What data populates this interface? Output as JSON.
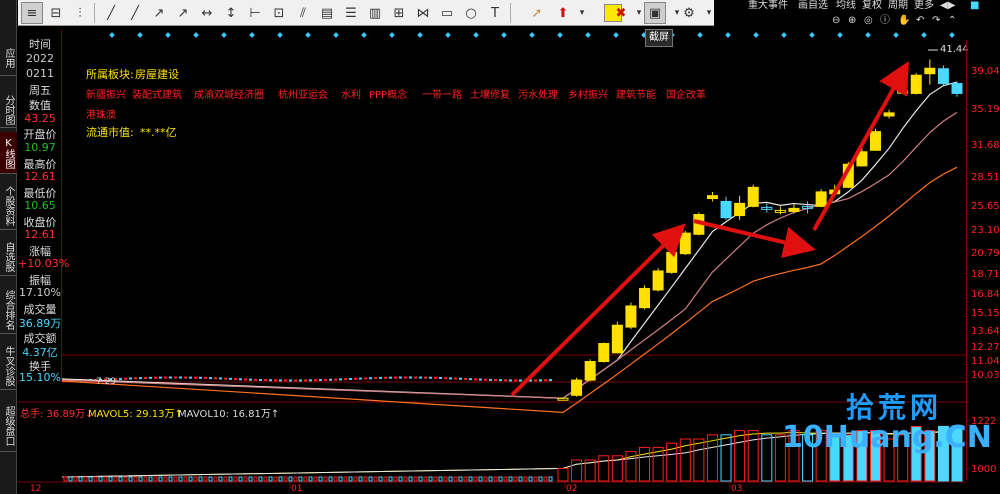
{
  "side_tabs": [
    {
      "label": "应用",
      "active": false
    },
    {
      "label": "分时图",
      "active": false
    },
    {
      "label": "K线图",
      "active": true
    },
    {
      "label": "个股资料",
      "active": false
    },
    {
      "label": "自选股",
      "active": false
    },
    {
      "label": "综合排名",
      "active": false
    },
    {
      "label": "牛叉诊股",
      "active": false
    },
    {
      "label": "超级盘口",
      "active": false
    }
  ],
  "info": {
    "time_label": "时间",
    "year": "2022",
    "date": "0211",
    "weekday": "周五",
    "value_label": "数值",
    "value": "43.25",
    "open_label": "开盘价",
    "open": "10.97",
    "high_label": "最高价",
    "high": "12.61",
    "low_label": "最低价",
    "low": "10.65",
    "close_label": "收盘价",
    "close": "12.61",
    "change_label": "涨幅",
    "change": "+10.03%",
    "amplitude_label": "振幅",
    "amplitude": "17.10%",
    "volume_label": "成交量",
    "volume": "36.89万",
    "turnover_label": "成交额",
    "turnover": "4.37亿",
    "turnover_rate_label": "换手",
    "turnover_rate": "15.10%"
  },
  "toolbar": {
    "tooltip": "截屏"
  },
  "top_menu": [
    "重大事件",
    "画自选",
    "均线",
    "复权",
    "周期",
    "更多"
  ],
  "stock_meta": {
    "sector_label": "所属板块:",
    "sector_value": "房屋建设",
    "concept_items": [
      "新疆振兴",
      "装配式建筑",
      "成渝双城经济圈",
      "杭州亚运会",
      "水利",
      "PPP概念",
      "一带一路",
      "土壤修复",
      "污水处理",
      "乡村振兴",
      "建筑节能",
      "国企改革"
    ],
    "concept_extra": "港珠澳",
    "float_label": "流通市值:",
    "float_value": "**.**亿"
  },
  "price_label": "7.29",
  "peak_label": "41.44",
  "volume_header": {
    "total": "总手: 36.89万↓",
    "ma5": "MAVOL5: 29.13万↑",
    "ma10": "MAVOL10: 16.81万↑"
  },
  "axis": {
    "y_ticks": [
      "39.04",
      "35.19",
      "31.68",
      "28.51",
      "25.65",
      "23.10",
      "20.79",
      "18.71",
      "16.84",
      "15.15",
      "13.64",
      "12.27",
      "11.04",
      "10.03"
    ],
    "vol_ticks": [
      "1222",
      "1000"
    ],
    "x_ticks": [
      "12",
      "01",
      "02",
      "03"
    ]
  },
  "watermark": {
    "cn": "拾荒网",
    "en": "10Huang.CN"
  },
  "colors": {
    "up": "#ff2020",
    "down": "#4ad8ff",
    "yellow": "#ffe000",
    "arrow": "#e01010",
    "ma_white": "#e8e8e8",
    "ma_pink": "#d08080",
    "ma_orange": "#ff7020"
  },
  "chart_data": {
    "type": "candlestick",
    "candles": [
      {
        "o": 7.29,
        "c": 7.29,
        "h": 7.32,
        "l": 7.26
      },
      {
        "o": 7.4,
        "c": 8.0,
        "h": 8.1,
        "l": 7.35
      },
      {
        "o": 8.0,
        "c": 8.8,
        "h": 8.9,
        "l": 7.95
      },
      {
        "o": 8.8,
        "c": 9.65,
        "h": 9.7,
        "l": 8.75
      },
      {
        "o": 9.2,
        "c": 10.6,
        "h": 10.8,
        "l": 9.2
      },
      {
        "o": 10.5,
        "c": 11.7,
        "h": 11.9,
        "l": 10.4
      },
      {
        "o": 11.6,
        "c": 12.8,
        "h": 13.0,
        "l": 11.5
      },
      {
        "o": 12.7,
        "c": 14.0,
        "h": 14.2,
        "l": 12.6
      },
      {
        "o": 13.9,
        "c": 15.4,
        "h": 15.6,
        "l": 13.8
      },
      {
        "o": 15.3,
        "c": 17.0,
        "h": 17.2,
        "l": 15.2
      },
      {
        "o": 16.9,
        "c": 18.7,
        "h": 18.9,
        "l": 16.8
      },
      {
        "o": 20.3,
        "c": 20.6,
        "h": 21.0,
        "l": 20.0
      },
      {
        "o": 20.0,
        "c": 18.4,
        "h": 20.5,
        "l": 18.2
      },
      {
        "o": 18.6,
        "c": 19.8,
        "h": 20.6,
        "l": 18.2
      },
      {
        "o": 19.5,
        "c": 21.5,
        "h": 21.8,
        "l": 19.4
      },
      {
        "o": 19.4,
        "c": 19.2,
        "h": 19.8,
        "l": 18.9
      },
      {
        "o": 19.0,
        "c": 19.1,
        "h": 19.5,
        "l": 18.7
      },
      {
        "o": 19.0,
        "c": 19.3,
        "h": 19.7,
        "l": 18.8
      },
      {
        "o": 19.5,
        "c": 19.3,
        "h": 20.0,
        "l": 18.8
      },
      {
        "o": 19.5,
        "c": 21.0,
        "h": 21.3,
        "l": 19.4
      },
      {
        "o": 20.8,
        "c": 21.2,
        "h": 21.8,
        "l": 20.7
      },
      {
        "o": 21.5,
        "c": 24.2,
        "h": 24.5,
        "l": 21.4
      },
      {
        "o": 24.0,
        "c": 25.8,
        "h": 26.2,
        "l": 23.9
      },
      {
        "o": 26.0,
        "c": 28.6,
        "h": 29.0,
        "l": 25.9
      },
      {
        "o": 31.0,
        "c": 31.5,
        "h": 32.0,
        "l": 30.6
      },
      {
        "o": 35.1,
        "c": 35.2,
        "h": 35.6,
        "l": 34.8
      },
      {
        "o": 34.8,
        "c": 38.2,
        "h": 38.6,
        "l": 34.6
      },
      {
        "o": 38.5,
        "c": 39.6,
        "h": 41.44,
        "l": 36.4
      },
      {
        "o": 39.5,
        "c": 36.6,
        "h": 40.2,
        "l": 36.3
      },
      {
        "o": 36.6,
        "c": 34.8,
        "h": 37.0,
        "l": 34.2
      }
    ],
    "volumes": [
      3,
      5,
      5,
      6,
      6,
      7,
      8,
      8,
      9,
      10,
      10,
      11,
      11,
      12,
      12,
      11,
      11,
      12,
      11,
      12,
      11,
      11,
      12,
      12,
      10,
      11,
      13,
      12,
      13,
      13
    ]
  }
}
